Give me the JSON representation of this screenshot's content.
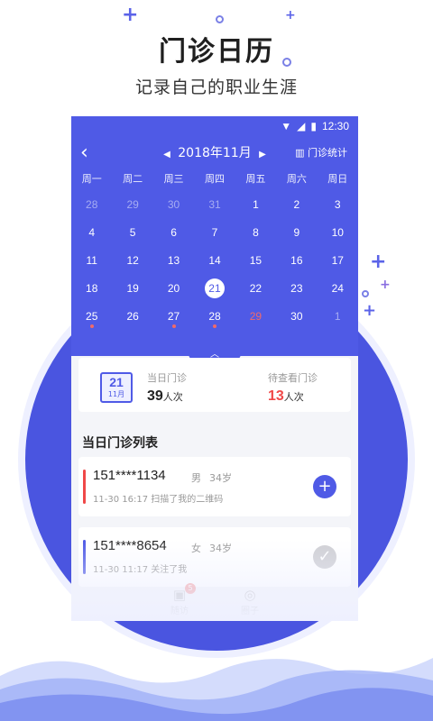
{
  "promo": {
    "title": "门诊日历",
    "subtitle": "记录自己的职业生涯"
  },
  "status_bar": {
    "time": "12:30"
  },
  "calendar": {
    "month_label": "2018年11月",
    "stats_label": "门诊统计",
    "weekdays": [
      "周一",
      "周二",
      "周三",
      "周四",
      "周五",
      "周六",
      "周日"
    ],
    "days": [
      {
        "d": "28",
        "muted": true
      },
      {
        "d": "29",
        "muted": true
      },
      {
        "d": "30",
        "muted": true
      },
      {
        "d": "31",
        "muted": true
      },
      {
        "d": "1"
      },
      {
        "d": "2"
      },
      {
        "d": "3"
      },
      {
        "d": "4"
      },
      {
        "d": "5"
      },
      {
        "d": "6"
      },
      {
        "d": "7"
      },
      {
        "d": "8"
      },
      {
        "d": "9"
      },
      {
        "d": "10"
      },
      {
        "d": "11"
      },
      {
        "d": "12"
      },
      {
        "d": "13"
      },
      {
        "d": "14"
      },
      {
        "d": "15"
      },
      {
        "d": "16"
      },
      {
        "d": "17"
      },
      {
        "d": "18"
      },
      {
        "d": "19"
      },
      {
        "d": "20"
      },
      {
        "d": "21",
        "selected": true
      },
      {
        "d": "22"
      },
      {
        "d": "23"
      },
      {
        "d": "24"
      },
      {
        "d": "25",
        "dot": true
      },
      {
        "d": "26"
      },
      {
        "d": "27",
        "dot": true
      },
      {
        "d": "28",
        "dot": true
      },
      {
        "d": "29",
        "red": true
      },
      {
        "d": "30"
      },
      {
        "d": "1",
        "muted": true
      }
    ]
  },
  "summary": {
    "icon_day": "21",
    "icon_month": "11月",
    "today_label": "当日门诊",
    "today_value": "39",
    "today_unit": "人次",
    "pending_label": "待查看门诊",
    "pending_value": "13",
    "pending_unit": "人次"
  },
  "list": {
    "title": "当日门诊列表",
    "items": [
      {
        "phone": "151****1134",
        "gender": "男",
        "age": "34岁",
        "detail": "11-30 16:17 扫描了我的二维码",
        "bar_color": "#f04848",
        "action": "add",
        "action_color": "#4f5ae6"
      },
      {
        "phone": "151****8654",
        "gender": "女",
        "age": "34岁",
        "detail": "11-30 11:17 关注了我",
        "bar_color": "#4f5ae6",
        "action": "done",
        "action_color": "#cfcfd4"
      }
    ]
  },
  "tabbar": {
    "tabs": [
      {
        "label": "随访",
        "badge": "5"
      },
      {
        "label": "圈子"
      }
    ]
  }
}
